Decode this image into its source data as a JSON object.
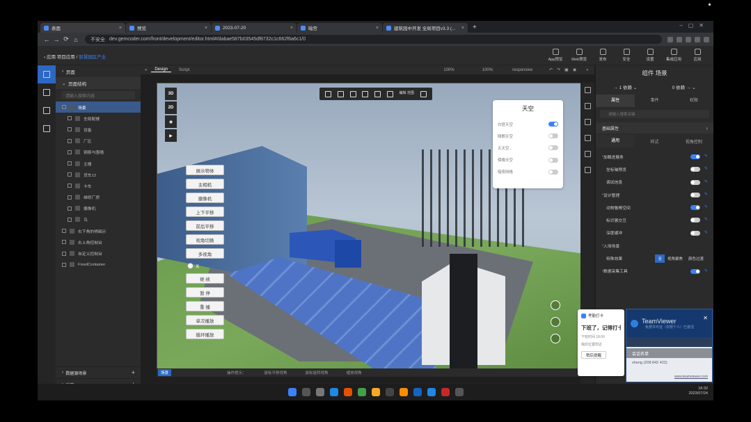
{
  "browser": {
    "tabs": [
      {
        "label": "表面"
      },
      {
        "label": "预览"
      },
      {
        "label": "2023-07-20"
      },
      {
        "label": "暗宫"
      },
      {
        "label": "建筑园中开发 全局项目v3.3 (..."
      }
    ],
    "url_prefix": "不安全",
    "url": "dev.gemcoder.com/front/development/editor.html#/dabae587b03545df8732c1c662f6a6c1/0"
  },
  "app": {
    "breadcrumb": {
      "root": "应用",
      "app": "项目应用",
      "page": "智慧园区产业"
    },
    "top_icons": [
      "App预览",
      "Web预览",
      "发布",
      "安全",
      "设置",
      "集成应用",
      "应用"
    ]
  },
  "tree": {
    "page_label": "页面",
    "structure_label": "页面结构",
    "search_placeholder": "请输入搜索内容",
    "nodes": [
      {
        "label": "场景"
      },
      {
        "label": "全局配楼"
      },
      {
        "label": "设备"
      },
      {
        "label": "厂区"
      },
      {
        "label": "钢筋与围墙"
      },
      {
        "label": "主楼"
      },
      {
        "label": "货车12"
      },
      {
        "label": "卡车"
      },
      {
        "label": "维修厂房"
      },
      {
        "label": "摄像机"
      },
      {
        "label": "鸟"
      },
      {
        "label": "右下角的明细示"
      },
      {
        "label": "右上角控制台"
      },
      {
        "label": "自定义控制台"
      },
      {
        "label": "FixedContainer"
      }
    ],
    "footer": [
      {
        "label": "数据源场景"
      },
      {
        "label": "弹窗"
      }
    ]
  },
  "editor": {
    "tabs": [
      "Design",
      "Script"
    ],
    "zoom1": "100%",
    "zoom2": "100%",
    "responsive": "responsive"
  },
  "canvas": {
    "view_buttons": [
      "3D",
      "2D",
      "◉",
      "▶"
    ],
    "toolbar_text": "编辑\n范围",
    "buttons": [
      "展示物体",
      "主相机",
      "摄像机",
      "上下平移",
      "前后平移",
      "视角切换",
      "多视角",
      "继 续",
      "暂 停",
      "重 播",
      "单次播放",
      "循环播放"
    ],
    "small_toggle_label": "关",
    "sky_panel": {
      "title": "天空",
      "rows": [
        {
          "label": "白昼天空",
          "on": true
        },
        {
          "label": "晴朗天空",
          "on": false
        },
        {
          "label": "五天空...",
          "on": false
        },
        {
          "label": "傍晚天空",
          "on": false
        },
        {
          "label": "暗夜网格",
          "on": false
        }
      ]
    },
    "footer_tag": "场景",
    "hints": [
      "操作提示：",
      "鼠标平移视角",
      "鼠标旋转视角",
      "缩放视角"
    ]
  },
  "props": {
    "title": "组件 场景",
    "select_left": "1 依赖",
    "select_right": "0 依赖",
    "tabs": [
      "属性",
      "事件",
      "权限"
    ],
    "search_placeholder": "请输入搜索关键",
    "basic_label": "基础属性",
    "subtabs": [
      "通用",
      "样式",
      "视角控制"
    ],
    "rows": [
      {
        "label": "加载进展条",
        "on": true,
        "arrow": true
      },
      {
        "label": "坐标轴预览",
        "on": false
      },
      {
        "label": "调试信息",
        "on": false
      },
      {
        "label": "设计管理",
        "on": false,
        "arrow": true
      },
      {
        "label": "动物鲁棒空间",
        "on": true
      },
      {
        "label": "标识展交互",
        "on": false
      },
      {
        "label": "深度缓冲",
        "on": false
      },
      {
        "label": "入场场景",
        "arrow": true
      },
      {
        "label": "特殊效果",
        "segments": [
          "无",
          "视角聚焦",
          "颜色过渡"
        ]
      },
      {
        "label": "数据采集工具",
        "on": true,
        "arrow": true
      }
    ]
  },
  "popup": {
    "header": "考勤打卡",
    "title": "下班了，记得打卡",
    "time": "下班时间 18:00",
    "loc": "我的位置附近",
    "button": "稍后提醒"
  },
  "teamviewer": {
    "name": "TeamViewer",
    "sub": "免费许可证（仅限个人）已激活",
    "session": "会话名单",
    "user": "sheng (208 842 422)",
    "link": "www.teamviewer.com"
  },
  "tray": {
    "time": "18:32",
    "date": "2023/07/24"
  }
}
